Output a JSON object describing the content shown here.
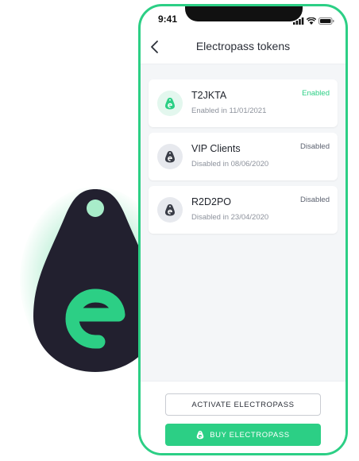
{
  "status_bar": {
    "time": "9:41"
  },
  "header": {
    "title": "Electropass tokens"
  },
  "tokens": [
    {
      "name": "T2JKTA",
      "subtitle": "Enabled in 11/01/2021",
      "status": "Enabled",
      "active": true
    },
    {
      "name": "VIP Clients",
      "subtitle": "Disabled in 08/06/2020",
      "status": "Disabled",
      "active": false
    },
    {
      "name": "R2D2PO",
      "subtitle": "Disabled in 23/04/2020",
      "status": "Disabled",
      "active": false
    }
  ],
  "actions": {
    "activate_label": "ACTIVATE ELECTROPASS",
    "buy_label": "BUY ELECTROPASS"
  },
  "colors": {
    "accent": "#2ccf85",
    "fob": "#22202f",
    "text": "#1f232b"
  }
}
